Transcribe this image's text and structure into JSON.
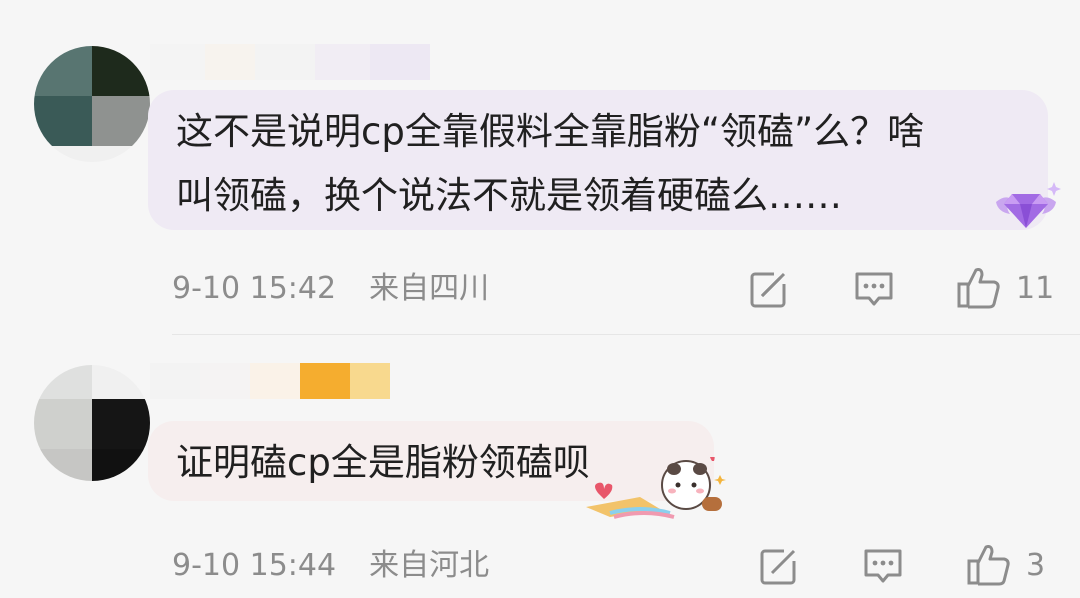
{
  "comments": [
    {
      "text": "这不是说明cp全靠假料全靠脂粉“领磕”么？啥\n叫领磕，换个说法不就是领着硬磕么……",
      "time": "9-10 15:42",
      "location": "来自四川",
      "like_count": "11",
      "bubble_color": "#efeaf4",
      "badge": "diamond-badge-icon"
    },
    {
      "text": "证明磕cp全是脂粉领磕呗",
      "time": "9-10 15:44",
      "location": "来自河北",
      "like_count": "3",
      "bubble_color": "#f6eeee",
      "badge": "raccoon-sticker-icon"
    }
  ],
  "icons": {
    "edit": "edit-icon",
    "reply": "reply-icon",
    "like": "thumbs-up-icon"
  },
  "colors": {
    "text": "#202020",
    "meta": "#8c8c8c",
    "background": "#f6f6f6"
  }
}
